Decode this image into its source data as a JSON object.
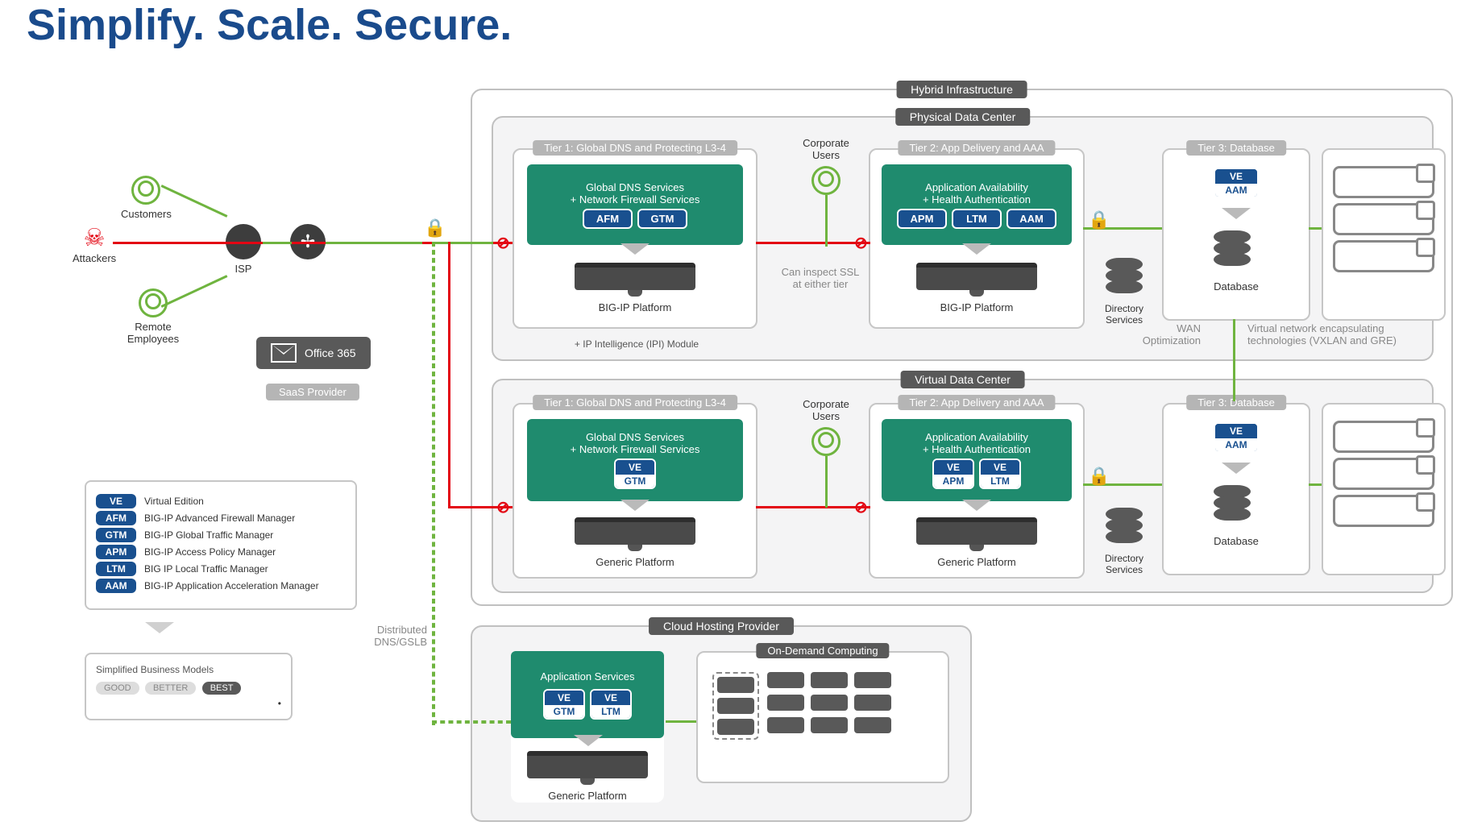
{
  "title": "Simplify. Scale. Secure.",
  "actors": {
    "attackers": "Attackers",
    "customers": "Customers",
    "remote": "Remote Employees",
    "isp": "ISP",
    "corporate_users": "Corporate Users"
  },
  "saas": {
    "office365": "Office 365",
    "provider": "SaaS Provider"
  },
  "hybrid": {
    "label": "Hybrid Infrastructure"
  },
  "physical": {
    "label": "Physical Data Center",
    "tier1": {
      "label": "Tier 1: Global DNS and Protecting L3-4",
      "svc1": "Global DNS Services",
      "svc2": "+ Network Firewall Services",
      "chips": [
        "AFM",
        "GTM"
      ],
      "platform": "BIG-IP Platform",
      "ipi": "+ IP Intelligence (IPI) Module"
    },
    "ssl_note": "Can inspect SSL at either tier",
    "tier2": {
      "label": "Tier 2: App Delivery and AAA",
      "svc1": "Application Availability",
      "svc2": "+ Health Authentication",
      "chips": [
        "APM",
        "LTM",
        "AAM"
      ],
      "platform": "BIG-IP Platform"
    },
    "dirsvc": "Directory Services",
    "tier3": {
      "label": "Tier 3: Database",
      "ve": "VE",
      "aam": "AAM",
      "db": "Database"
    },
    "wan": "WAN Optimization",
    "vnet": "Virtual network encapsulating technologies (VXLAN and GRE)"
  },
  "virtual": {
    "label": "Virtual Data Center",
    "tier1": {
      "label": "Tier 1: Global DNS and Protecting L3-4",
      "svc1": "Global DNS Services",
      "svc2": "+ Network Firewall Services",
      "chip_ve": "VE",
      "chip": "GTM",
      "platform": "Generic Platform"
    },
    "tier2": {
      "label": "Tier 2: App Delivery and AAA",
      "svc1": "Application Availability",
      "svc2": "+ Health Authentication",
      "chip_ve": "VE",
      "chips": [
        "APM",
        "LTM"
      ],
      "platform": "Generic Platform"
    },
    "dirsvc": "Directory Services",
    "tier3": {
      "label": "Tier 3: Database",
      "ve": "VE",
      "aam": "AAM",
      "db": "Database"
    }
  },
  "cloud": {
    "label": "Cloud Hosting Provider",
    "appsvc": "Application Services",
    "chip_ve": "VE",
    "chips": [
      "GTM",
      "LTM"
    ],
    "platform": "Generic Platform",
    "ondemand": "On-Demand Computing"
  },
  "distributed": "Distributed DNS/GSLB",
  "legend": {
    "items": [
      {
        "c": "VE",
        "t": "Virtual Edition"
      },
      {
        "c": "AFM",
        "t": "BIG-IP Advanced Firewall Manager"
      },
      {
        "c": "GTM",
        "t": "BIG-IP Global Traffic Manager"
      },
      {
        "c": "APM",
        "t": "BIG-IP Access Policy Manager"
      },
      {
        "c": "LTM",
        "t": "BIG IP Local Traffic Manager"
      },
      {
        "c": "AAM",
        "t": "BIG-IP Application Acceleration Manager"
      }
    ]
  },
  "bmodel": {
    "title": "Simplified Business Models",
    "good": "GOOD",
    "better": "BETTER",
    "best": "BEST"
  }
}
